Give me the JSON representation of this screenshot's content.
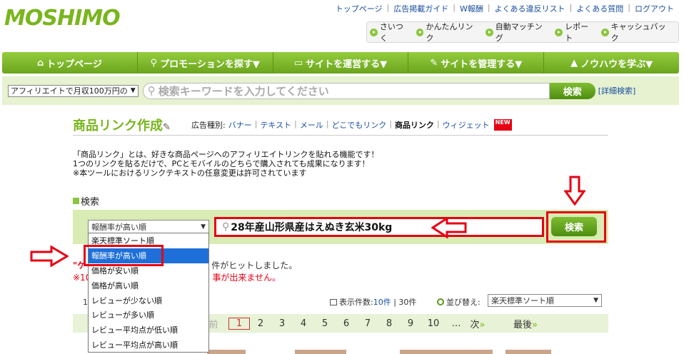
{
  "header": {
    "logo": "MOSHIMO",
    "top_links": [
      "トップページ",
      "広告掲載ガイド",
      "W報酬",
      "よくある違反リスト",
      "よくある質問",
      "ログアウト"
    ],
    "quick_links": [
      "さいつく",
      "かんたんリンク",
      "自動マッチング",
      "レポート",
      "キャッシュバック"
    ]
  },
  "nav": [
    {
      "label": "トップページ",
      "icon": "home-icon",
      "symbol": "⌂"
    },
    {
      "label": "プロモーションを探す▼",
      "icon": "search-icon",
      "symbol": "⚲"
    },
    {
      "label": "サイトを運営する▼",
      "icon": "monitor-icon",
      "symbol": "▭"
    },
    {
      "label": "サイトを管理する▼",
      "icon": "wrench-icon",
      "symbol": "✎"
    },
    {
      "label": "ノウハウを学ぶ▼",
      "icon": "mortarboard-icon",
      "symbol": "▲"
    }
  ],
  "top_search": {
    "select_value": "アフィリエイトで月収100万円の",
    "placeholder": "検索キーワードを入力してください",
    "button": "検索",
    "advanced": "[詳細検索]"
  },
  "page": {
    "title": "商品リンク作成",
    "ad_type_label": "広告種別:",
    "ad_types": [
      "バナー",
      "テキスト",
      "メール",
      "どこでもリンク",
      "商品リンク",
      "ウィジェット"
    ],
    "new_badge": "NEW",
    "desc": [
      "「商品リンク」とは、好きな商品ページへのアフィリエイトリンクを貼れる機能です！",
      "1つのリンクを貼るだけで、PCとモバイルのどちらで購入されても成果になります！",
      "※本ツールにおけるリンクテキストの任意変更は許可されています"
    ],
    "search_head": "検索"
  },
  "search": {
    "sort_value": "報酬率が高い順",
    "keyword": "28年産山形県産はえぬき玄米30kg",
    "button": "検索"
  },
  "dropdown": {
    "options": [
      "楽天標準ソート順",
      "報酬率が高い順",
      "価格が安い順",
      "価格が高い順",
      "レビューが少ない順",
      "レビューが多い順",
      "レビュー平均点が低い順",
      "レビュー平均点が高い順"
    ],
    "selected_index": 1
  },
  "results": {
    "hit_prefix": "\"ケ",
    "hit_text": "件がヒットしました。",
    "warn_prefix": "※10",
    "warn_text": "事が出来ません。",
    "count_prefix": "1件"
  },
  "list_controls": {
    "display_label": "表示件数:",
    "display_options": [
      "10件",
      "30件"
    ],
    "order_label": "並び替え:",
    "order_value": "楽天標準ソート順"
  },
  "pager": {
    "prev": "前",
    "pages": [
      "1",
      "2",
      "3",
      "4",
      "5",
      "6",
      "7",
      "8",
      "9",
      "10"
    ],
    "current": "1",
    "ellipsis": "…",
    "next": "次",
    "last": "最後"
  },
  "colors": {
    "accent_green": "#79b51d",
    "highlight_red": "#e60012",
    "link_blue": "#1a4fa0"
  }
}
